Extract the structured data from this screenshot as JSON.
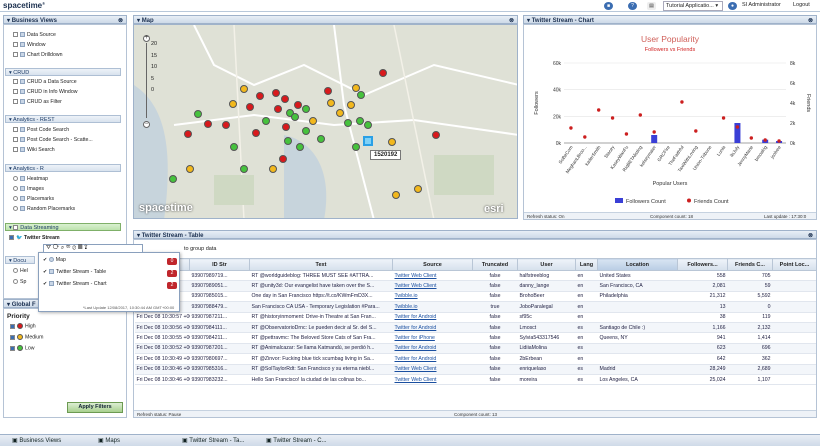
{
  "app": {
    "logo": "spacetime",
    "logo_tm": "®"
  },
  "topbar": {
    "selector": "Tutorial Applicatio...",
    "user": "SI Administrator",
    "logout": "Logout"
  },
  "left": {
    "title": "Business Views",
    "sections": [
      {
        "title": "",
        "items": [
          "Data Source",
          "Window",
          "Chart Drilldown"
        ]
      },
      {
        "title": "CRUD",
        "items": [
          "CRUD a Data Source",
          "CRUD in Info Window",
          "CRUD as Filter"
        ]
      },
      {
        "title": "Analytics - REST",
        "items": [
          "Post Code Search",
          "Post Code Search - Scatte...",
          "Wiki Search"
        ]
      },
      {
        "title": "Analytics - R",
        "items": [
          "Heatmap",
          "Images",
          "Placemarks",
          "Random Placemarks"
        ]
      },
      {
        "title": "Data Streaming",
        "items": [
          "Twitter Stream"
        ]
      }
    ],
    "docs_title": "Docu",
    "doc_items": [
      "Hel",
      "Sp"
    ],
    "global_filter": "Global F",
    "priority_label": "Priority",
    "priorities": [
      {
        "label": "High",
        "color": "#d9191c"
      },
      {
        "label": "Medium",
        "color": "#f2b81d"
      },
      {
        "label": "Low",
        "color": "#46c23d"
      }
    ],
    "apply_filters": "Apply Filters"
  },
  "popup": {
    "rows": [
      {
        "label": "Map",
        "count": "0"
      },
      {
        "label": "Twitter Stream - Table",
        "count": "2"
      },
      {
        "label": "Twitter Stream - Chart",
        "count": "2"
      }
    ],
    "footnote": "*Last Update 12/08/2017, 10:30:44 AM GMT+00:00"
  },
  "map": {
    "title": "Map",
    "zoom_ticks": [
      "20",
      "15",
      "10",
      "5",
      "0"
    ],
    "zoom_plus": "+",
    "zoom_minus": "−",
    "tooltip": "1520192",
    "watermark": "spacetime",
    "esri": "esri"
  },
  "chart": {
    "title": "Twitter Stream - Chart",
    "status": "Refresh status: On",
    "component": "Component count: 18",
    "last_update": "Last update : 17:30:0"
  },
  "chart_data": {
    "type": "bar",
    "title": "User Popularity",
    "subtitle": "Followers vs Friends",
    "xlabel": "Popular Users",
    "ylabel": "Followers",
    "y2label": "Friends",
    "ylim": [
      0,
      60000
    ],
    "y2lim": [
      0,
      8000
    ],
    "yticks": [
      "60k",
      "40k",
      "20k",
      "0k"
    ],
    "y2ticks": [
      "8k",
      "6k",
      "4k",
      "2k",
      "0k"
    ],
    "categories": [
      "SoBeCom",
      "MeghanLBroo...",
      "kaderSmith",
      "Stacey",
      "KaseyWanFu",
      "RiqBETAlisting",
      "kelseymaier",
      "GRCFire",
      "TheFaithful",
      "TaxiWithLoving",
      "Union-Tribune",
      "Lunia",
      "ilsJuly",
      "JennyMarie",
      "bmoalrig",
      "jsolvee"
    ],
    "series": [
      {
        "name": "Followers Count",
        "color": "#3a3fd6",
        "values": [
          0,
          0,
          0,
          0,
          0,
          0,
          6000,
          0,
          0,
          0,
          0,
          0,
          15000,
          0,
          2500,
          1500
        ]
      },
      {
        "name": "Friends Count",
        "color": "#cc1f1f",
        "values": [
          1500,
          600,
          3300,
          2500,
          900,
          2800,
          1100,
          0,
          4100,
          1200,
          0,
          2500,
          1600,
          500,
          300,
          200
        ]
      }
    ],
    "legend": "bottom"
  },
  "table": {
    "title": "Twitter Stream - Table",
    "group_hint": "to group data",
    "columns": [
      "",
      "ID Str",
      "Text",
      "Source",
      "Truncated",
      "User",
      "Lang",
      "Location",
      "Followers...",
      "Friends C...",
      "Point Loc..."
    ],
    "rows": [
      [
        "+00...",
        "93907989719...",
        "RT @worldguideblog: THREE MUST SEE #ATTRA...",
        "Twitter Web Client",
        "false",
        "halfstreeblog",
        "en",
        "United States",
        "558",
        "705",
        ""
      ],
      [
        "+00...",
        "93907989051...",
        "RT @unity3d: Our evangelist have taken over the S...",
        "Twitter Web Client",
        "false",
        "danny_lange",
        "en",
        "San Francisco, CA",
        "2,081",
        "59",
        ""
      ],
      [
        "+00...",
        "93907985015...",
        "One day in San Francisco https://t.co/KWmFmD3X...",
        "Twibble.io",
        "false",
        "BrohoBeer",
        "en",
        "Philadelphia",
        "21,312",
        "5,592",
        ""
      ],
      [
        "+00...",
        "93907988479...",
        "San Francisco CA USA - Temporary Legislation #Para...",
        "Twibble.io",
        "true",
        "JoboParalegal",
        "en",
        "",
        "13",
        "0",
        ""
      ],
      [
        "Fri Dec 08 10:30:57 +00...",
        "93907987211...",
        "RT @historyinmoment: Drive-in Theatre at San Fran...",
        "Twitter for Android",
        "false",
        "sf95c",
        "en",
        "",
        "38",
        "119",
        ""
      ],
      [
        "Fri Dec 08 10:30:56 +00...",
        "93907984111...",
        "RT @ObservatorioDrnc: Le pueden decir al Sr. del S...",
        "Twitter for Android",
        "false",
        "Lmosct",
        "es",
        "Santiago de Chile :)",
        "1,166",
        "2,132",
        ""
      ],
      [
        "Fri Dec 08 10:30:55 +00...",
        "93907984211...",
        "RT @pettravmc: The Beloved Store Cats of San Fra...",
        "Twitter for iPhone",
        "false",
        "Sylvia543317546",
        "en",
        "Queens, NY",
        "941",
        "1,414",
        ""
      ],
      [
        "Fri Dec 08 10:30:52 +00...",
        "93907987201...",
        "RT @Animalcazar: Se llama Katmandú, se perdió h...",
        "Twitter for Android",
        "false",
        "LidiiaMolina",
        "es",
        "",
        "623",
        "696",
        ""
      ],
      [
        "Fri Dec 08 10:30:49 +00...",
        "93907980697...",
        "RT @Zinvor: Fucking blue tick scumbag living in Sa...",
        "Twitter for Android",
        "false",
        "2bErbean",
        "en",
        "",
        "642",
        "362",
        ""
      ],
      [
        "Fri Dec 08 10:30:46 +00...",
        "93907985316...",
        "RT @SolTaylorRdt: San Francisco y su eterna niebl...",
        "Twitter Web Client",
        "false",
        "enriquelaso",
        "es",
        "Madrid",
        "28,249",
        "2,689",
        ""
      ],
      [
        "Fri Dec 08 10:30:46 +00...",
        "93907983232...",
        "Hello San Francisco! la ciudad de las colinas bo...",
        "Twitter Web Client",
        "false",
        "moreira",
        "es",
        "Los Angeles, CA",
        "25,024",
        "1,107",
        ""
      ]
    ],
    "status": "Refresh status: Pause",
    "component": "Component count: 13"
  },
  "bottom_tabs": [
    "Business Views",
    "Maps",
    "Twitter Stream - Ta...",
    "Twitter Stream - C..."
  ],
  "colors": {
    "high": "#d9191c",
    "medium": "#f2b81d",
    "low": "#46c23d",
    "accent": "#3b6db1"
  }
}
